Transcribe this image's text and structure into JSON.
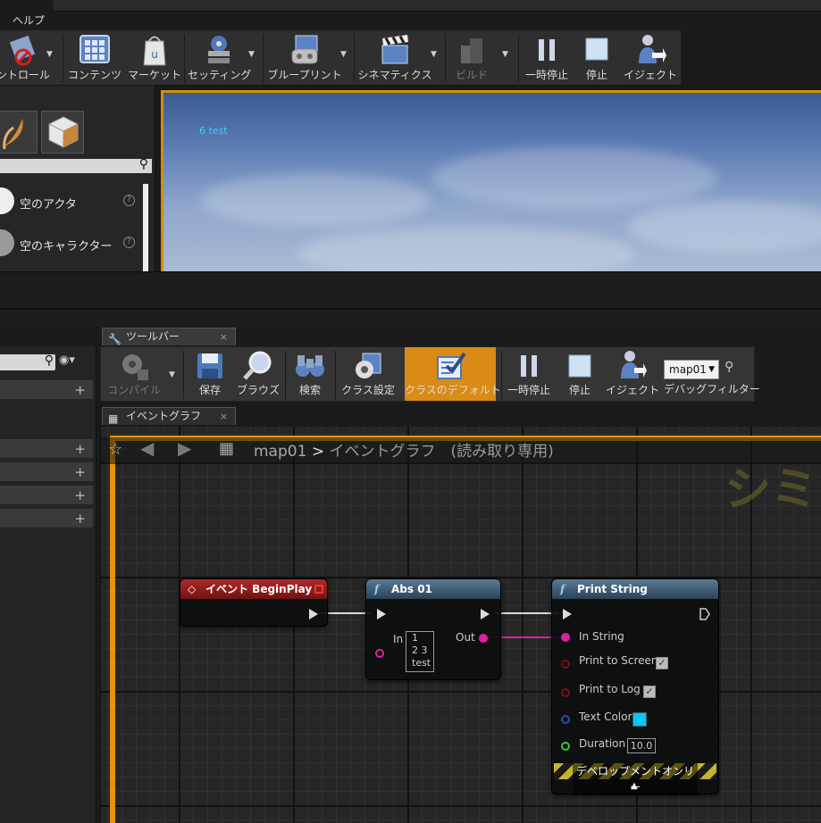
{
  "menubar": {
    "help": "ヘルプ"
  },
  "main_toolbar": {
    "buttons": [
      {
        "label": "ントロール",
        "icon": "world-settings-icon"
      },
      {
        "label": "コンテンツ",
        "icon": "content-browser-icon"
      },
      {
        "label": "マーケット",
        "icon": "marketplace-icon"
      },
      {
        "label": "セッティング",
        "icon": "settings-icon"
      },
      {
        "label": "ブループリント",
        "icon": "blueprint-icon"
      },
      {
        "label": "シネマティクス",
        "icon": "cinematics-icon"
      },
      {
        "label": "ビルド",
        "icon": "build-icon",
        "disabled": true
      },
      {
        "label": "一時停止",
        "icon": "pause-icon"
      },
      {
        "label": "停止",
        "icon": "stop-icon"
      },
      {
        "label": "イジェクト",
        "icon": "eject-icon"
      }
    ]
  },
  "place_panel": {
    "items": [
      {
        "label": "空のアクタ",
        "help": "?"
      },
      {
        "label": "空のキャラクター",
        "help": "?"
      }
    ]
  },
  "viewport": {
    "debug_text": "6 test"
  },
  "bp_tabs": {
    "toolbar_tab": "ツールバー",
    "graph_tab": "イベントグラフ",
    "close": "×"
  },
  "bp_toolbar": {
    "buttons": [
      {
        "label": "コンパイル",
        "icon": "compile-icon",
        "disabled": true
      },
      {
        "label": "保存",
        "icon": "save-icon"
      },
      {
        "label": "ブラウズ",
        "icon": "browse-icon"
      },
      {
        "label": "検索",
        "icon": "find-icon"
      },
      {
        "label": "クラス設定",
        "icon": "class-settings-icon"
      },
      {
        "label": "クラスのデフォルト",
        "icon": "class-defaults-icon",
        "active": true
      },
      {
        "label": "一時停止",
        "icon": "pause-icon"
      },
      {
        "label": "停止",
        "icon": "stop-icon"
      },
      {
        "label": "イジェクト",
        "icon": "eject-icon"
      },
      {
        "label": "デバッグフィルター",
        "icon": "debug-filter-icon"
      }
    ],
    "debug_object": "map01"
  },
  "graph": {
    "breadcrumb_map": "map01",
    "breadcrumb_sep": ">",
    "breadcrumb_graph": "イベントグラフ　(読み取り専用)",
    "watermark": "シミ",
    "nodes": {
      "begin_play": {
        "title": "イベント BeginPlay"
      },
      "abs": {
        "title": "Abs 01",
        "in_label": "In",
        "out_label": "Out",
        "in_value_lines": [
          "1",
          "2 3",
          "test"
        ]
      },
      "print_string": {
        "title": "Print String",
        "in_string": "In String",
        "print_to_screen": "Print to Screen",
        "print_to_log": "Print to Log",
        "text_color": "Text Color",
        "duration": "Duration",
        "duration_value": "10.0",
        "dev_only": "デベロップメントオンリー",
        "text_color_swatch": "#00c8ff"
      }
    }
  },
  "colors": {
    "accent_orange": "#e5930b",
    "string_pin": "#e020a0",
    "active_button": "#d98b15"
  }
}
